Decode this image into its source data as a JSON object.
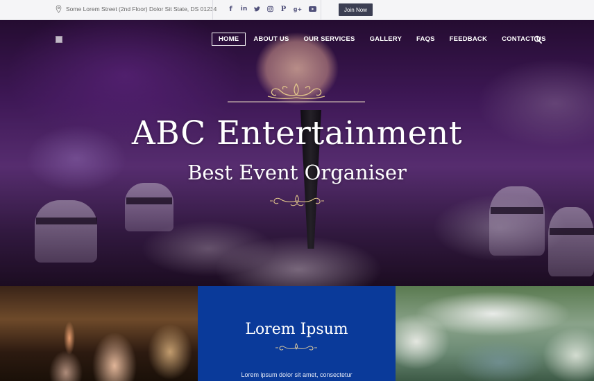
{
  "topbar": {
    "address": "Some Lorem Street (2nd Floor) Dolor Sit State, DS 01234",
    "social_icons": [
      "facebook-icon",
      "linkedin-icon",
      "twitter-icon",
      "instagram-icon",
      "pinterest-icon",
      "google-plus-icon",
      "youtube-icon"
    ],
    "join_label": "Join Now"
  },
  "nav": {
    "items": [
      "HOME",
      "ABOUT US",
      "OUR SERVICES",
      "GALLERY",
      "FAQS",
      "FEEDBACK",
      "CONTACT US"
    ],
    "active": "HOME"
  },
  "hero": {
    "title": "ABC Entertainment",
    "subtitle": "Best Event Organiser"
  },
  "feature": {
    "title": "Lorem Ipsum",
    "text": "Lorem ipsum dolor sit amet, consectetur"
  },
  "colors": {
    "topbar_bg": "#f5f5f7",
    "join_button": "#3b3e52",
    "feature_tile": "#0a3a9a",
    "social_icon": "#50507a"
  }
}
